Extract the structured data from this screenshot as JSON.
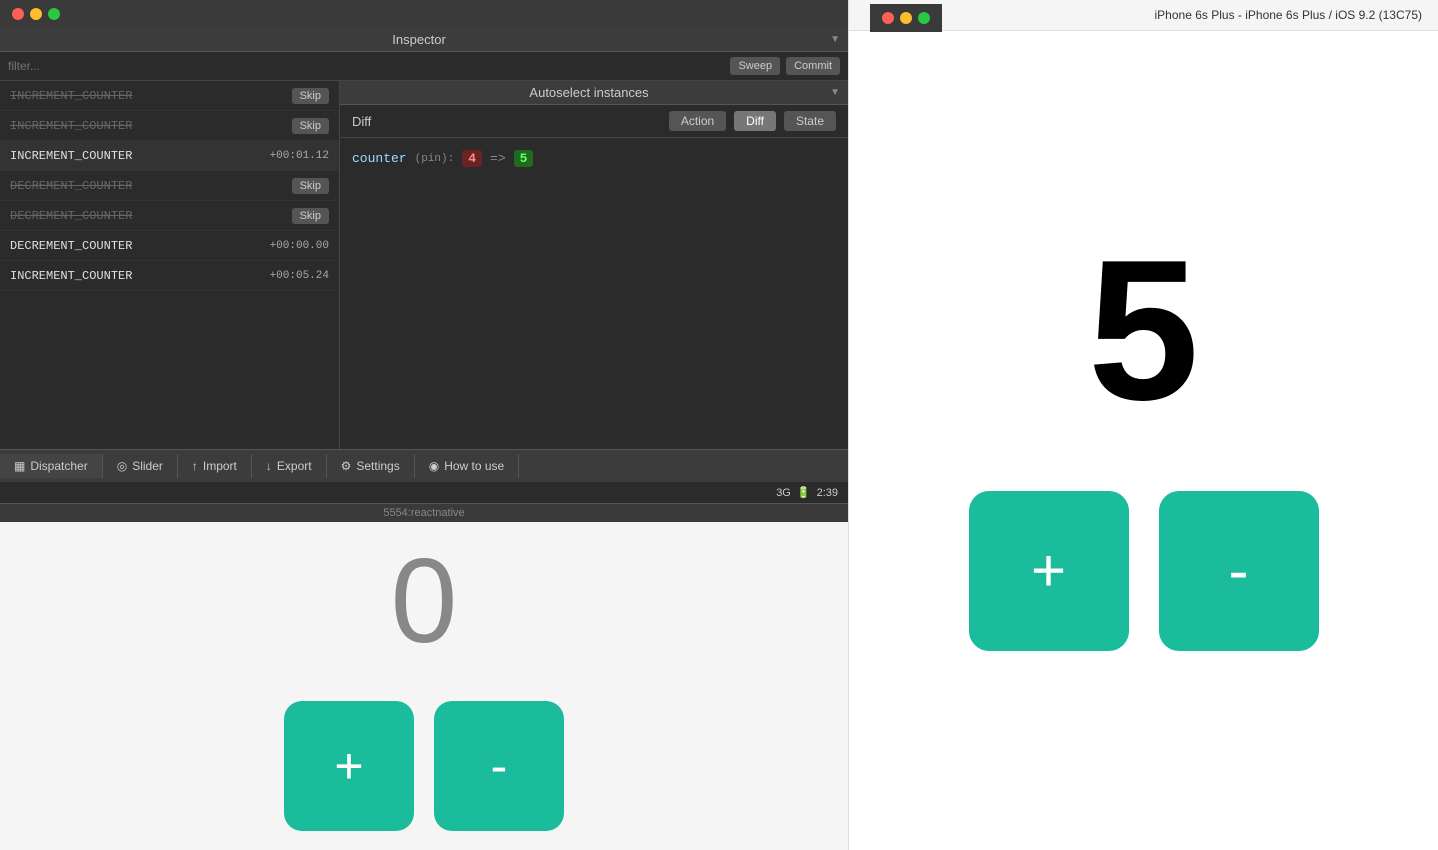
{
  "window": {
    "traffic_lights": [
      "red",
      "yellow",
      "green"
    ]
  },
  "inspector": {
    "title": "Inspector",
    "arrow": "▼",
    "filter_placeholder": "filter...",
    "sweep_label": "Sweep",
    "commit_label": "Commit"
  },
  "autoselect": {
    "title": "Autoselect instances",
    "arrow": "▼"
  },
  "action_list": [
    {
      "id": 0,
      "name": "INCREMENT_COUNTER",
      "time": "",
      "state": "skipped"
    },
    {
      "id": 1,
      "name": "INCREMENT_COUNTER",
      "time": "",
      "state": "skipped"
    },
    {
      "id": 2,
      "name": "INCREMENT_COUNTER",
      "time": "+00:01.12",
      "state": "active"
    },
    {
      "id": 3,
      "name": "DECREMENT_COUNTER",
      "time": "",
      "state": "skipped"
    },
    {
      "id": 4,
      "name": "DECREMENT_COUNTER",
      "time": "",
      "state": "skipped"
    },
    {
      "id": 5,
      "name": "DECREMENT_COUNTER",
      "time": "+00:00.00",
      "state": "active"
    },
    {
      "id": 6,
      "name": "INCREMENT_COUNTER",
      "time": "+00:05.24",
      "state": "active"
    }
  ],
  "diff_pane": {
    "title": "Diff",
    "tabs": [
      "Action",
      "Diff",
      "State"
    ],
    "active_tab": "Diff",
    "diff_key": "counter",
    "diff_pin": "(pin):",
    "diff_old_value": "4",
    "diff_arrow": "=>",
    "diff_new_value": "5"
  },
  "toolbar": {
    "items": [
      {
        "id": "dispatcher",
        "icon": "▦",
        "label": "Dispatcher"
      },
      {
        "id": "slider",
        "icon": "◎",
        "label": "Slider"
      },
      {
        "id": "import",
        "icon": "↑",
        "label": "Import"
      },
      {
        "id": "export",
        "icon": "↓",
        "label": "Export"
      },
      {
        "id": "settings",
        "icon": "⚙",
        "label": "Settings"
      },
      {
        "id": "how-to-use",
        "icon": "◉",
        "label": "How to use"
      }
    ]
  },
  "status_bar": {
    "text": "5554:reactnative"
  },
  "phone_status": {
    "network": "3G",
    "time": "2:39"
  },
  "phone_simulator": {
    "counter_value": "0",
    "plus_label": "+",
    "minus_label": "-"
  },
  "right_panel": {
    "title": "iPhone 6s Plus - iPhone 6s Plus / iOS 9.2 (13C75)",
    "counter_value": "5",
    "plus_label": "+",
    "minus_label": "-"
  },
  "skip_label": "Skip"
}
